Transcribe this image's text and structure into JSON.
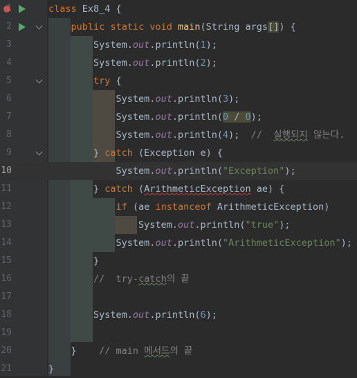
{
  "editor": {
    "current_line": 10,
    "lines": [
      {
        "n": "1",
        "html": "<span class='kw'>class</span> Ex8_4 {",
        "bp": true,
        "run": true,
        "fold": false
      },
      {
        "n": "2",
        "html": "    <span class='kw'>public</span> <span class='kw'>static</span> <span class='kw'>void</span> <span class='fn'>main</span>(String args<span class='hl'>[]</span>) {",
        "bp": false,
        "run": true,
        "fold": true
      },
      {
        "n": "3",
        "html": "        System.<span class='fld'>out</span>.println(<span class='num'>1</span>);"
      },
      {
        "n": "4",
        "html": "        System.<span class='fld'>out</span>.println(<span class='num'>2</span>);"
      },
      {
        "n": "5",
        "html": "        <span class='kw'>try</span> {",
        "fold": true
      },
      {
        "n": "6",
        "html": "            System.<span class='fld'>out</span>.println(<span class='num'>3</span>);"
      },
      {
        "n": "7",
        "html": "            System.<span class='fld'>out</span>.println(<span class='hl'><span class='num'>0</span> / <span class='num'>0</span></span>);"
      },
      {
        "n": "8",
        "html": "            System.<span class='fld'>out</span>.println(<span class='num'>4</span>);  <span class='cmt'>//  <span class='wavy'>실행되지</span> 않는다.</span>"
      },
      {
        "n": "9",
        "html": "        } <span class='kw'>catch</span> (Exception e) {",
        "fold": true
      },
      {
        "n": "10",
        "html": "            System.<span class='fld'>out</span>.println(<span class='str'>\"Exception\"</span>);"
      },
      {
        "n": "11",
        "html": "        } <span class='kw'>catch</span> (<span class='wavyr'>ArithmeticException</span> ae) {"
      },
      {
        "n": "12",
        "html": "            <span class='kw'>if</span> (ae <span class='kw'>instanceof</span> ArithmeticException)"
      },
      {
        "n": "13",
        "html": "                System.<span class='fld'>out</span>.println(<span class='str'>\"true\"</span>);"
      },
      {
        "n": "14",
        "html": "            System.<span class='fld'>out</span>.println(<span class='str'>\"ArithmeticException\"</span>);"
      },
      {
        "n": "15",
        "html": "        }"
      },
      {
        "n": "16",
        "html": "        <span class='cmt'>//  try-<span class='wavy'>catch</span>의 끝</span>"
      },
      {
        "n": "17",
        "html": ""
      },
      {
        "n": "18",
        "html": "        System.<span class='fld'>out</span>.println(<span class='num'>6</span>);"
      },
      {
        "n": "19",
        "html": ""
      },
      {
        "n": "20",
        "html": "    }    <span class='cmt'>// main <span class='wavy'>메서드</span>의 끝</span>"
      },
      {
        "n": "21",
        "html": "}"
      }
    ]
  }
}
